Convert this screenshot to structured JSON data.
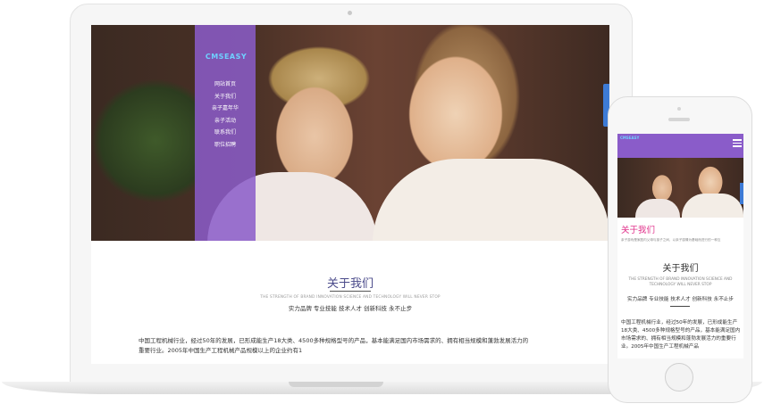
{
  "desktop": {
    "logo_text": "CMSEASY",
    "nav_items": [
      "网站首页",
      "关于我们",
      "亲子嘉年华",
      "亲子活动",
      "联系我们",
      "职位招聘"
    ],
    "about": {
      "title": "关于我们",
      "subtitle": "THE STRENGTH OF BRAND INNOVATION SCIENCE AND TECHNOLOGY WILL NEVER STOP",
      "tagline": "实力品牌 专业技能 技术人才 创新科技 永不止步",
      "body": "中国工程机械行业，经过50年的发展，已形成能生产18大类、4500多种规格型号的产品，基本能满足国内市场需求的、拥有相当规模和蓬勃发展活力的重要行业。2005年中国生产工程机械产品规模以上的企业约有1"
    }
  },
  "mobile": {
    "logo_text": "CMSEASY",
    "section_title": "关于我们",
    "section_text": "亲子游戏是家庭内父母与孩子之间，以亲子感情为基础而进行的一种互",
    "about": {
      "title": "关于我们",
      "subtitle": "THE STRENGTH OF BRAND INNOVATION SCIENCE AND TECHNOLOGY WILL NEVER STOP",
      "tagline": "实力品牌 专业技能 技术人才 创新科技 永不止步",
      "body": "中国工程机械行业，经过50年的发展，已形成能生产18大类、4500多种规格型号的产品，基本能满足国内市场需求的、拥有相当规模和蓬勃发展活力的重要行业。2005年中国生产工程机械产品"
    }
  },
  "colors": {
    "accent_purple": "#8a5cc9",
    "mobile_heading_pink": "#e0308a",
    "share_blue": "#3d7bd6"
  }
}
